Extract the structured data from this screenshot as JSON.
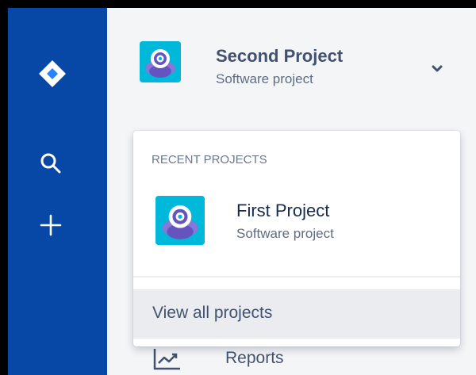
{
  "global_nav": {
    "logo_icon": "jira-logo-icon",
    "search_icon": "search-icon",
    "create_icon": "plus-icon",
    "background": "#0747a6"
  },
  "project_switcher": {
    "current_project": {
      "name": "Second Project",
      "type": "Software project",
      "avatar_icon": "robot-ufo-avatar-icon"
    },
    "toggle_icon": "chevron-down-icon",
    "dropdown": {
      "heading": "RECENT PROJECTS",
      "recent_projects": [
        {
          "name": "First Project",
          "type": "Software project",
          "avatar_icon": "robot-ufo-avatar-icon"
        }
      ],
      "view_all_label": "View all projects"
    }
  },
  "sidebar": {
    "items": [
      {
        "label": "Reports",
        "icon": "reports-chart-icon"
      }
    ]
  },
  "colors": {
    "avatar_bg": "#00b8d9",
    "avatar_ufo": "#8777d9",
    "text_primary": "#172b4d",
    "text_secondary": "#5e6c84"
  }
}
